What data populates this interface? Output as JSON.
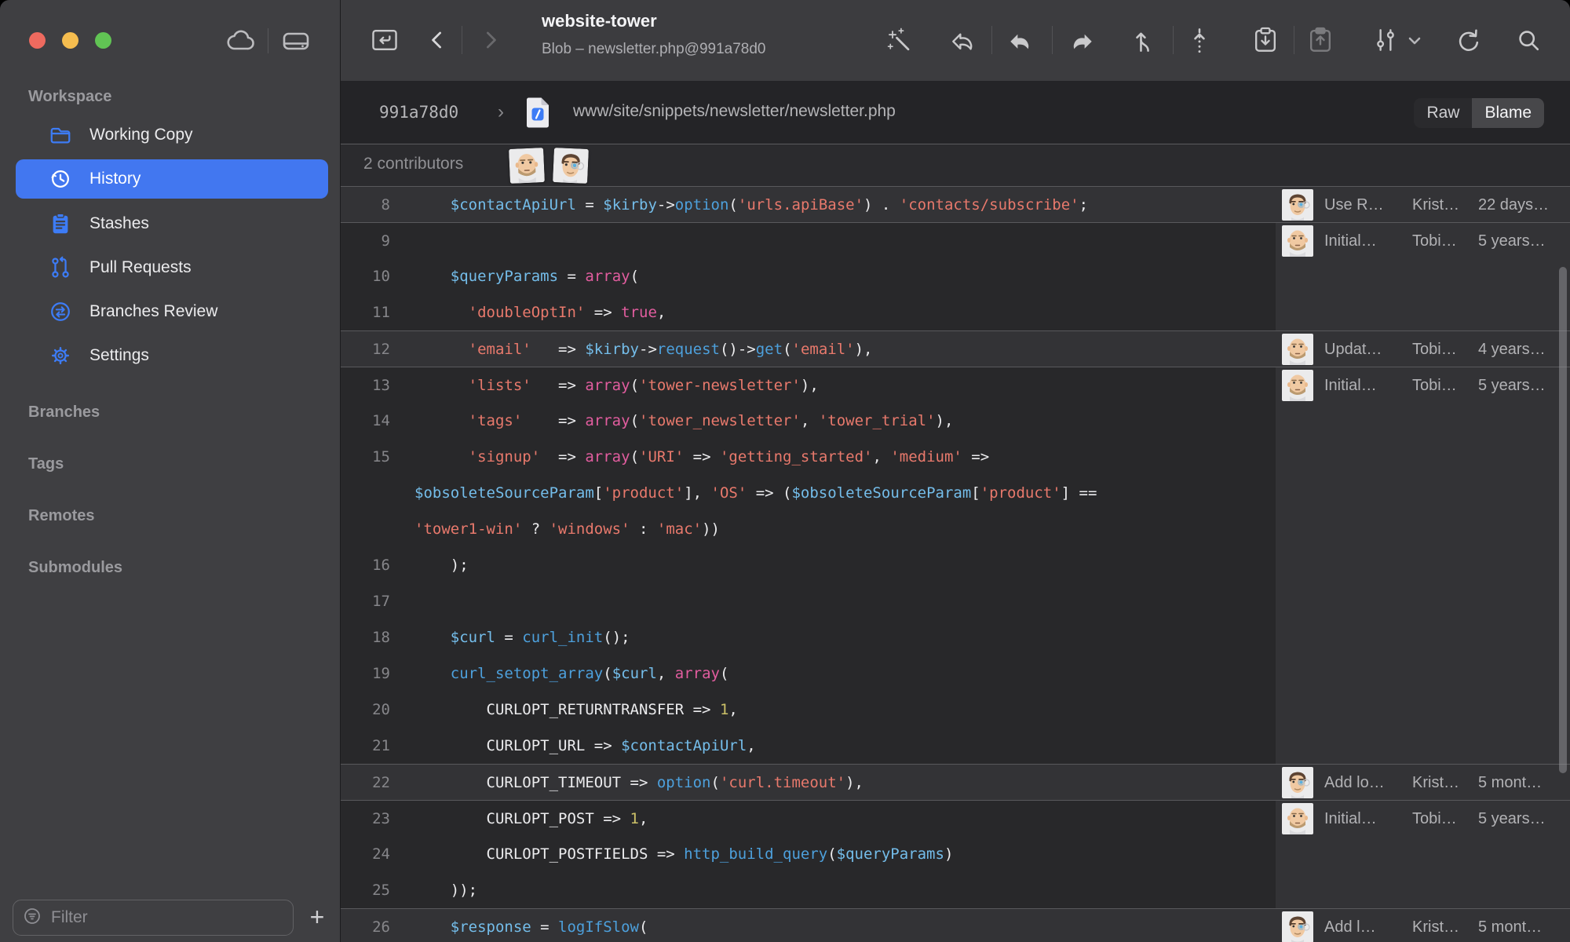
{
  "window_controls": {
    "close_color": "#ee6a5f",
    "minimize_color": "#f5bd4f",
    "zoom_color": "#61c454"
  },
  "titlebar": {
    "title": "website-tower",
    "subtitle": "Blob – newsletter.php@991a78d0"
  },
  "toolbar_icons": [
    "open-in-working-copy",
    "back",
    "forward",
    "magic-wand",
    "discard",
    "undo",
    "redo",
    "merge",
    "rebase",
    "stash",
    "apply-stash",
    "compare",
    "refresh",
    "search"
  ],
  "sidebar": {
    "workspace_label": "Workspace",
    "items": [
      {
        "label": "Working Copy",
        "icon": "folder-icon",
        "selected": false
      },
      {
        "label": "History",
        "icon": "history-clock-icon",
        "selected": true
      },
      {
        "label": "Stashes",
        "icon": "stash-clipboard-icon",
        "selected": false
      },
      {
        "label": "Pull Requests",
        "icon": "pull-request-icon",
        "selected": false
      },
      {
        "label": "Branches Review",
        "icon": "branches-review-icon",
        "selected": false
      },
      {
        "label": "Settings",
        "icon": "gear-icon",
        "selected": false
      }
    ],
    "sections": [
      {
        "label": "Branches"
      },
      {
        "label": "Tags"
      },
      {
        "label": "Remotes"
      },
      {
        "label": "Submodules"
      }
    ],
    "filter": {
      "placeholder": "Filter"
    },
    "add_button_label": "+"
  },
  "breadcrumb": {
    "commit_hash": "991a78d0",
    "separator": "›",
    "file_path": "www/site/snippets/newsletter/newsletter.php",
    "view_toggle": {
      "options": [
        "Raw",
        "Blame"
      ],
      "selected": "Blame"
    }
  },
  "contributors": {
    "label": "2 contributors",
    "avatars": [
      "tobias",
      "kristian"
    ]
  },
  "syntax_colors": {
    "variable": "#74bdea",
    "function": "#4da0dc",
    "string": "#e8796c",
    "keyword": "#e25d9f",
    "number": "#ccc168",
    "plain": "#ececee",
    "accent": "#4277f0"
  },
  "code": {
    "language": "php",
    "lines": [
      {
        "num": "8",
        "light": true,
        "sep": true,
        "blame": "b8",
        "seg": [
          [
            "pl",
            "    "
          ],
          [
            "var",
            "$contactApiUrl"
          ],
          [
            "pl",
            " = "
          ],
          [
            "var",
            "$kirby"
          ],
          [
            "pl",
            "->"
          ],
          [
            "fn",
            "option"
          ],
          [
            "pl",
            "("
          ],
          [
            "str",
            "'urls.apiBase'"
          ],
          [
            "pl",
            ") . "
          ],
          [
            "str",
            "'contacts/subscribe'"
          ],
          [
            "pl",
            ";"
          ]
        ]
      },
      {
        "num": "9",
        "light": false,
        "sep": true,
        "blame": "b9",
        "seg": []
      },
      {
        "num": "10",
        "light": false,
        "sep": false,
        "seg": [
          [
            "pl",
            "    "
          ],
          [
            "var",
            "$queryParams"
          ],
          [
            "pl",
            " = "
          ],
          [
            "kw",
            "array"
          ],
          [
            "pl",
            "("
          ]
        ]
      },
      {
        "num": "11",
        "light": false,
        "sep": false,
        "seg": [
          [
            "pl",
            "      "
          ],
          [
            "str",
            "'doubleOptIn'"
          ],
          [
            "pl",
            " => "
          ],
          [
            "kw",
            "true"
          ],
          [
            "pl",
            ","
          ]
        ]
      },
      {
        "num": "12",
        "light": true,
        "sep": true,
        "blame": "b12",
        "seg": [
          [
            "pl",
            "      "
          ],
          [
            "str",
            "'email'"
          ],
          [
            "pl",
            "   => "
          ],
          [
            "var",
            "$kirby"
          ],
          [
            "pl",
            "->"
          ],
          [
            "fn",
            "request"
          ],
          [
            "pl",
            "()->"
          ],
          [
            "fn",
            "get"
          ],
          [
            "pl",
            "("
          ],
          [
            "str",
            "'email'"
          ],
          [
            "pl",
            "),"
          ]
        ]
      },
      {
        "num": "13",
        "light": false,
        "sep": true,
        "blame": "b13",
        "seg": [
          [
            "pl",
            "      "
          ],
          [
            "str",
            "'lists'"
          ],
          [
            "pl",
            "   => "
          ],
          [
            "kw",
            "array"
          ],
          [
            "pl",
            "("
          ],
          [
            "str",
            "'tower-newsletter'"
          ],
          [
            "pl",
            "),"
          ]
        ]
      },
      {
        "num": "14",
        "light": false,
        "sep": false,
        "seg": [
          [
            "pl",
            "      "
          ],
          [
            "str",
            "'tags'"
          ],
          [
            "pl",
            "    => "
          ],
          [
            "kw",
            "array"
          ],
          [
            "pl",
            "("
          ],
          [
            "str",
            "'tower_newsletter'"
          ],
          [
            "pl",
            ", "
          ],
          [
            "str",
            "'tower_trial'"
          ],
          [
            "pl",
            "),"
          ]
        ]
      },
      {
        "num": "15",
        "light": false,
        "sep": false,
        "seg": [
          [
            "pl",
            "      "
          ],
          [
            "str",
            "'signup'"
          ],
          [
            "pl",
            "  => "
          ],
          [
            "kw",
            "array"
          ],
          [
            "pl",
            "("
          ],
          [
            "str",
            "'URI'"
          ],
          [
            "pl",
            " => "
          ],
          [
            "str",
            "'getting_started'"
          ],
          [
            "pl",
            ", "
          ],
          [
            "str",
            "'medium'"
          ],
          [
            "pl",
            " =>"
          ]
        ]
      },
      {
        "num": "",
        "light": false,
        "sep": false,
        "seg": [
          [
            "var",
            "$obsoleteSourceParam"
          ],
          [
            "pl",
            "["
          ],
          [
            "str",
            "'product'"
          ],
          [
            "pl",
            "], "
          ],
          [
            "str",
            "'OS'"
          ],
          [
            "pl",
            " => ("
          ],
          [
            "var",
            "$obsoleteSourceParam"
          ],
          [
            "pl",
            "["
          ],
          [
            "str",
            "'product'"
          ],
          [
            "pl",
            "] =="
          ]
        ]
      },
      {
        "num": "",
        "light": false,
        "sep": false,
        "seg": [
          [
            "str",
            "'tower1-win'"
          ],
          [
            "pl",
            " ? "
          ],
          [
            "str",
            "'windows'"
          ],
          [
            "pl",
            " : "
          ],
          [
            "str",
            "'mac'"
          ],
          [
            "pl",
            "))"
          ]
        ]
      },
      {
        "num": "16",
        "light": false,
        "sep": false,
        "seg": [
          [
            "pl",
            "    );"
          ]
        ]
      },
      {
        "num": "17",
        "light": false,
        "sep": false,
        "seg": []
      },
      {
        "num": "18",
        "light": false,
        "sep": false,
        "seg": [
          [
            "pl",
            "    "
          ],
          [
            "var",
            "$curl"
          ],
          [
            "pl",
            " = "
          ],
          [
            "fn",
            "curl_init"
          ],
          [
            "pl",
            "();"
          ]
        ]
      },
      {
        "num": "19",
        "light": false,
        "sep": false,
        "seg": [
          [
            "pl",
            "    "
          ],
          [
            "fn",
            "curl_setopt_array"
          ],
          [
            "pl",
            "("
          ],
          [
            "var",
            "$curl"
          ],
          [
            "pl",
            ", "
          ],
          [
            "kw",
            "array"
          ],
          [
            "pl",
            "("
          ]
        ]
      },
      {
        "num": "20",
        "light": false,
        "sep": false,
        "seg": [
          [
            "pl",
            "        CURLOPT_RETURNTRANSFER => "
          ],
          [
            "num",
            "1"
          ],
          [
            "pl",
            ","
          ]
        ]
      },
      {
        "num": "21",
        "light": false,
        "sep": false,
        "seg": [
          [
            "pl",
            "        CURLOPT_URL => "
          ],
          [
            "var",
            "$contactApiUrl"
          ],
          [
            "pl",
            ","
          ]
        ]
      },
      {
        "num": "22",
        "light": true,
        "sep": true,
        "blame": "b22",
        "seg": [
          [
            "pl",
            "        CURLOPT_TIMEOUT => "
          ],
          [
            "fn",
            "option"
          ],
          [
            "pl",
            "("
          ],
          [
            "str",
            "'curl.timeout'"
          ],
          [
            "pl",
            "),"
          ]
        ]
      },
      {
        "num": "23",
        "light": false,
        "sep": true,
        "blame": "b23",
        "seg": [
          [
            "pl",
            "        CURLOPT_POST => "
          ],
          [
            "num",
            "1"
          ],
          [
            "pl",
            ","
          ]
        ]
      },
      {
        "num": "24",
        "light": false,
        "sep": false,
        "seg": [
          [
            "pl",
            "        CURLOPT_POSTFIELDS => "
          ],
          [
            "fn",
            "http_build_query"
          ],
          [
            "pl",
            "("
          ],
          [
            "var",
            "$queryParams"
          ],
          [
            "pl",
            ")"
          ]
        ]
      },
      {
        "num": "25",
        "light": false,
        "sep": false,
        "seg": [
          [
            "pl",
            "    ));"
          ]
        ]
      },
      {
        "num": "26",
        "light": true,
        "sep": true,
        "blame": "b26",
        "seg": [
          [
            "pl",
            "    "
          ],
          [
            "var",
            "$response"
          ],
          [
            "pl",
            " = "
          ],
          [
            "fn",
            "logIfSlow"
          ],
          [
            "pl",
            "("
          ]
        ]
      }
    ]
  },
  "blame_entries": {
    "b8": {
      "avatar": "kristian",
      "message": "Use R…",
      "author": "Krist…",
      "date": "22 days…"
    },
    "b9": {
      "avatar": "tobias",
      "message": "Initial…",
      "author": "Tobi…",
      "date": "5 years…"
    },
    "b12": {
      "avatar": "tobias",
      "message": "Updat…",
      "author": "Tobi…",
      "date": "4 years…"
    },
    "b13": {
      "avatar": "tobias",
      "message": "Initial…",
      "author": "Tobi…",
      "date": "5 years…"
    },
    "b22": {
      "avatar": "kristian",
      "message": "Add lo…",
      "author": "Krist…",
      "date": "5 mont…"
    },
    "b23": {
      "avatar": "tobias",
      "message": "Initial…",
      "author": "Tobi…",
      "date": "5 years…"
    },
    "b26": {
      "avatar": "kristian",
      "message": "Add l…",
      "author": "Krist…",
      "date": "5 mont…"
    }
  }
}
